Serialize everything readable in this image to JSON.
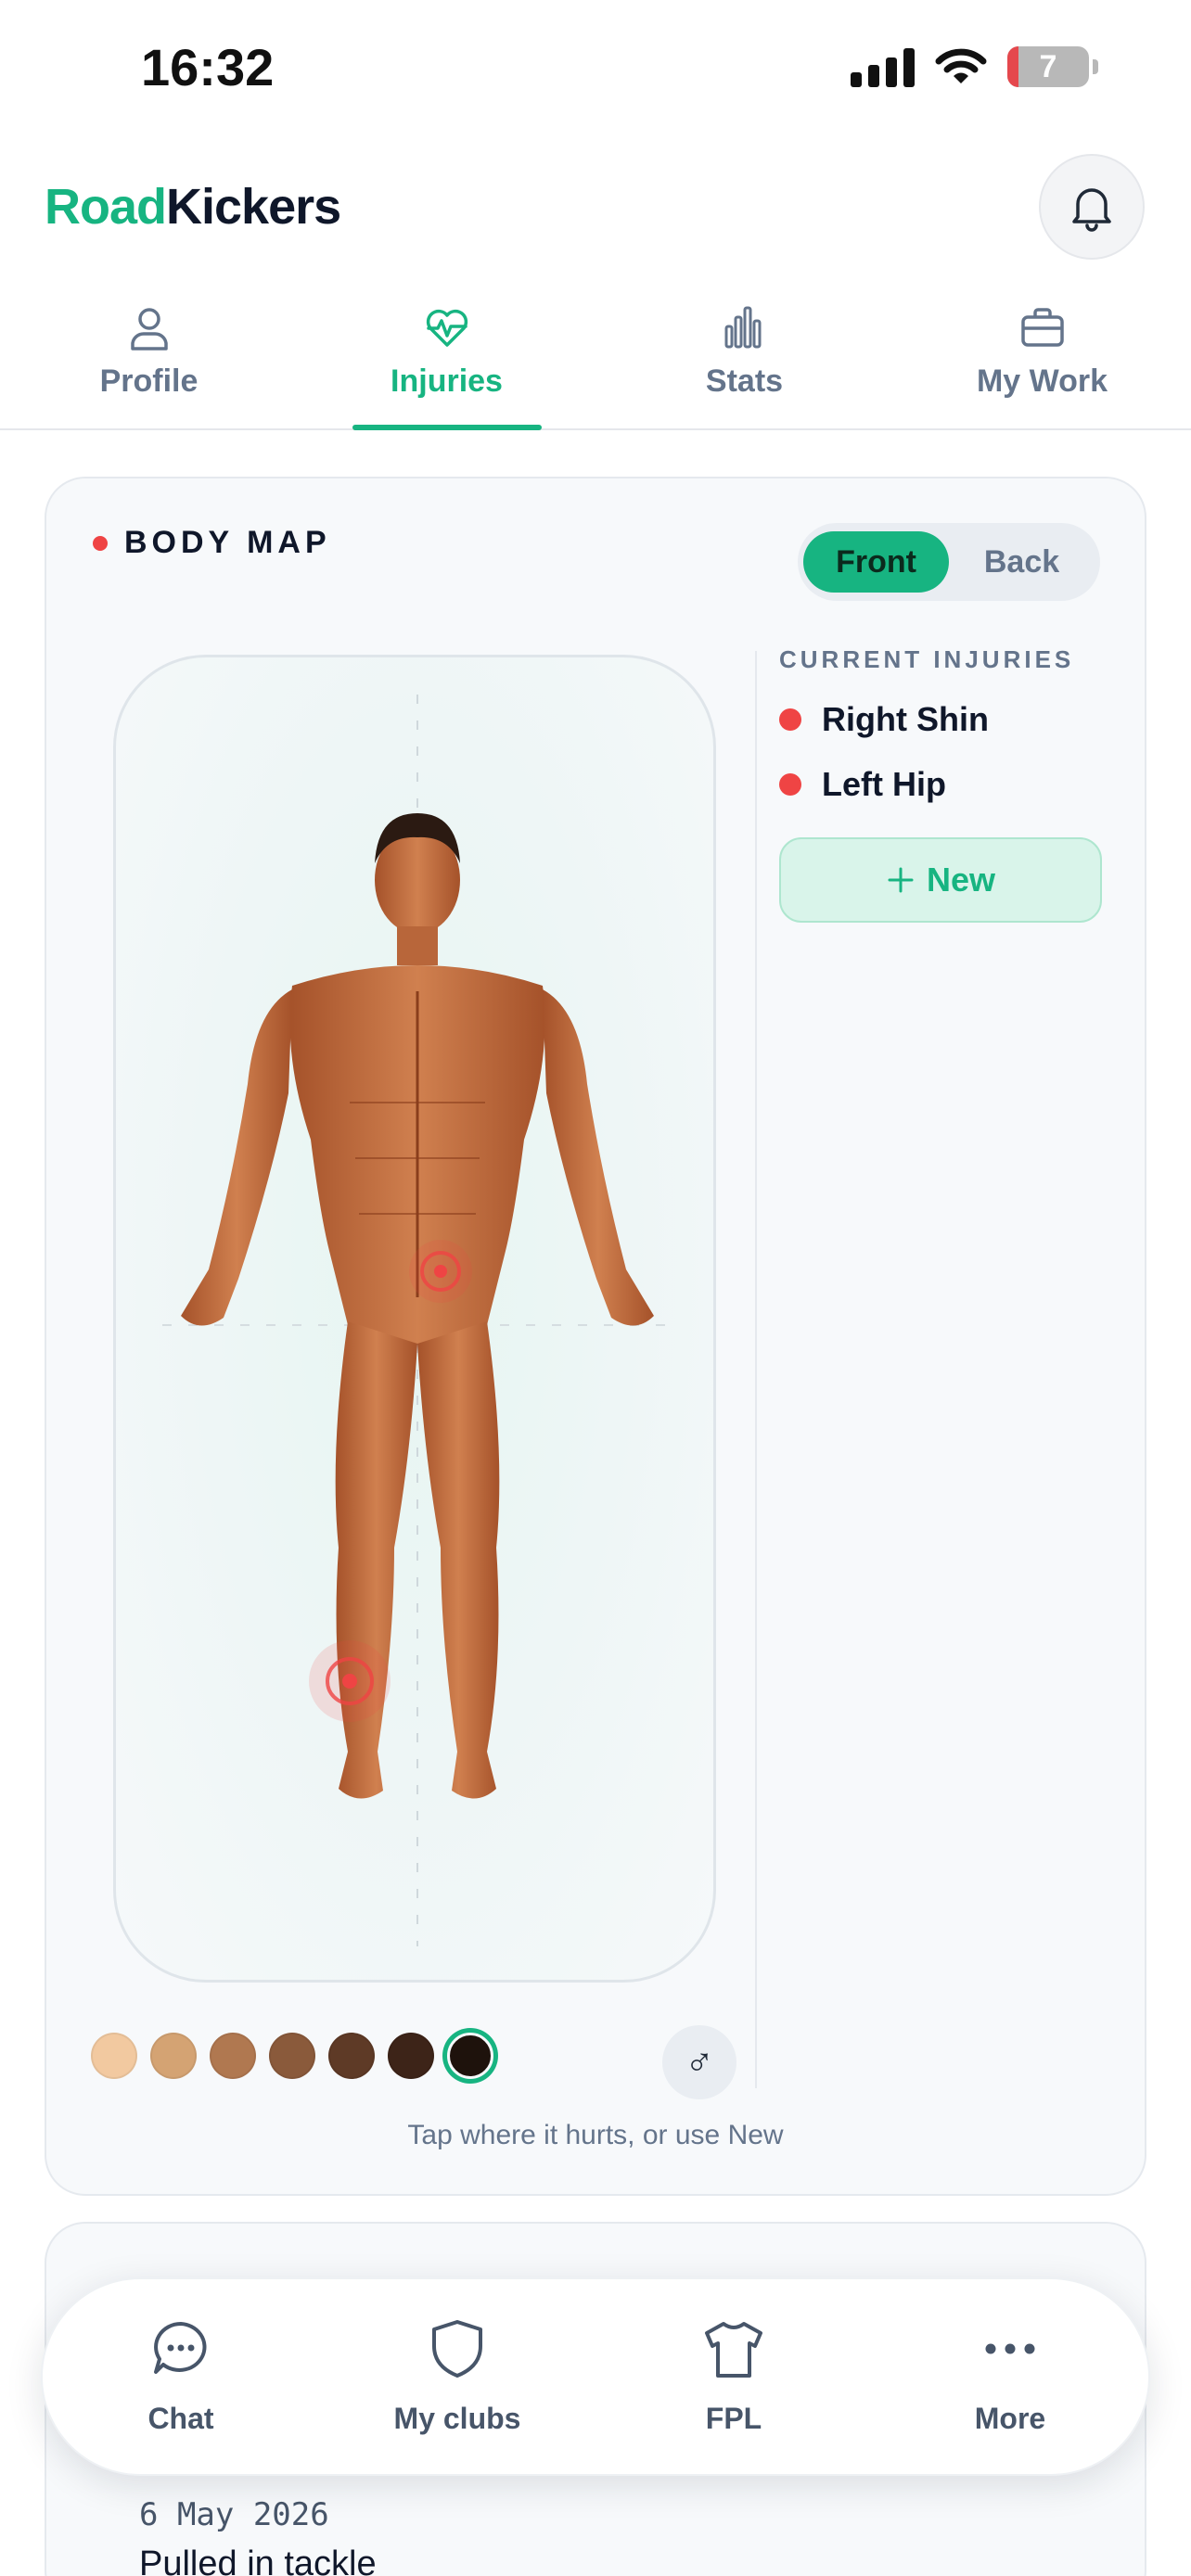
{
  "status": {
    "time": "16:32",
    "battery": "7"
  },
  "brand": {
    "part1": "Road",
    "part2": "Kickers"
  },
  "tabs": [
    {
      "label": "Profile",
      "icon": "user-icon"
    },
    {
      "label": "Injuries",
      "icon": "heart-pulse-icon",
      "active": true
    },
    {
      "label": "Stats",
      "icon": "bar-chart-icon"
    },
    {
      "label": "My Work",
      "icon": "briefcase-icon"
    }
  ],
  "body_map": {
    "title": "BODY MAP",
    "toggle": {
      "front": "Front",
      "back": "Back",
      "selected": "Front"
    },
    "current_heading": "CURRENT INJURIES",
    "injuries": [
      "Right Shin",
      "Left Hip"
    ],
    "new_label": "New",
    "hint": "Tap where it hurts, or use New",
    "gender_symbol": "♂",
    "skin_tones": [
      "#f2c9a0",
      "#d4a373",
      "#b07850",
      "#8a5a3b",
      "#5e3a26",
      "#3d2418",
      "#1e120c"
    ],
    "selected_tone": 6
  },
  "log_entry": {
    "date": "6 May 2026",
    "description": "Pulled in tackle"
  },
  "bottom_nav": [
    {
      "label": "Chat",
      "icon": "chat-bubble-icon"
    },
    {
      "label": "My clubs",
      "icon": "shield-icon"
    },
    {
      "label": "FPL",
      "icon": "shirt-icon"
    },
    {
      "label": "More",
      "icon": "more-dots-icon"
    }
  ],
  "colors": {
    "accent": "#17b481",
    "injury": "#ef4444"
  }
}
